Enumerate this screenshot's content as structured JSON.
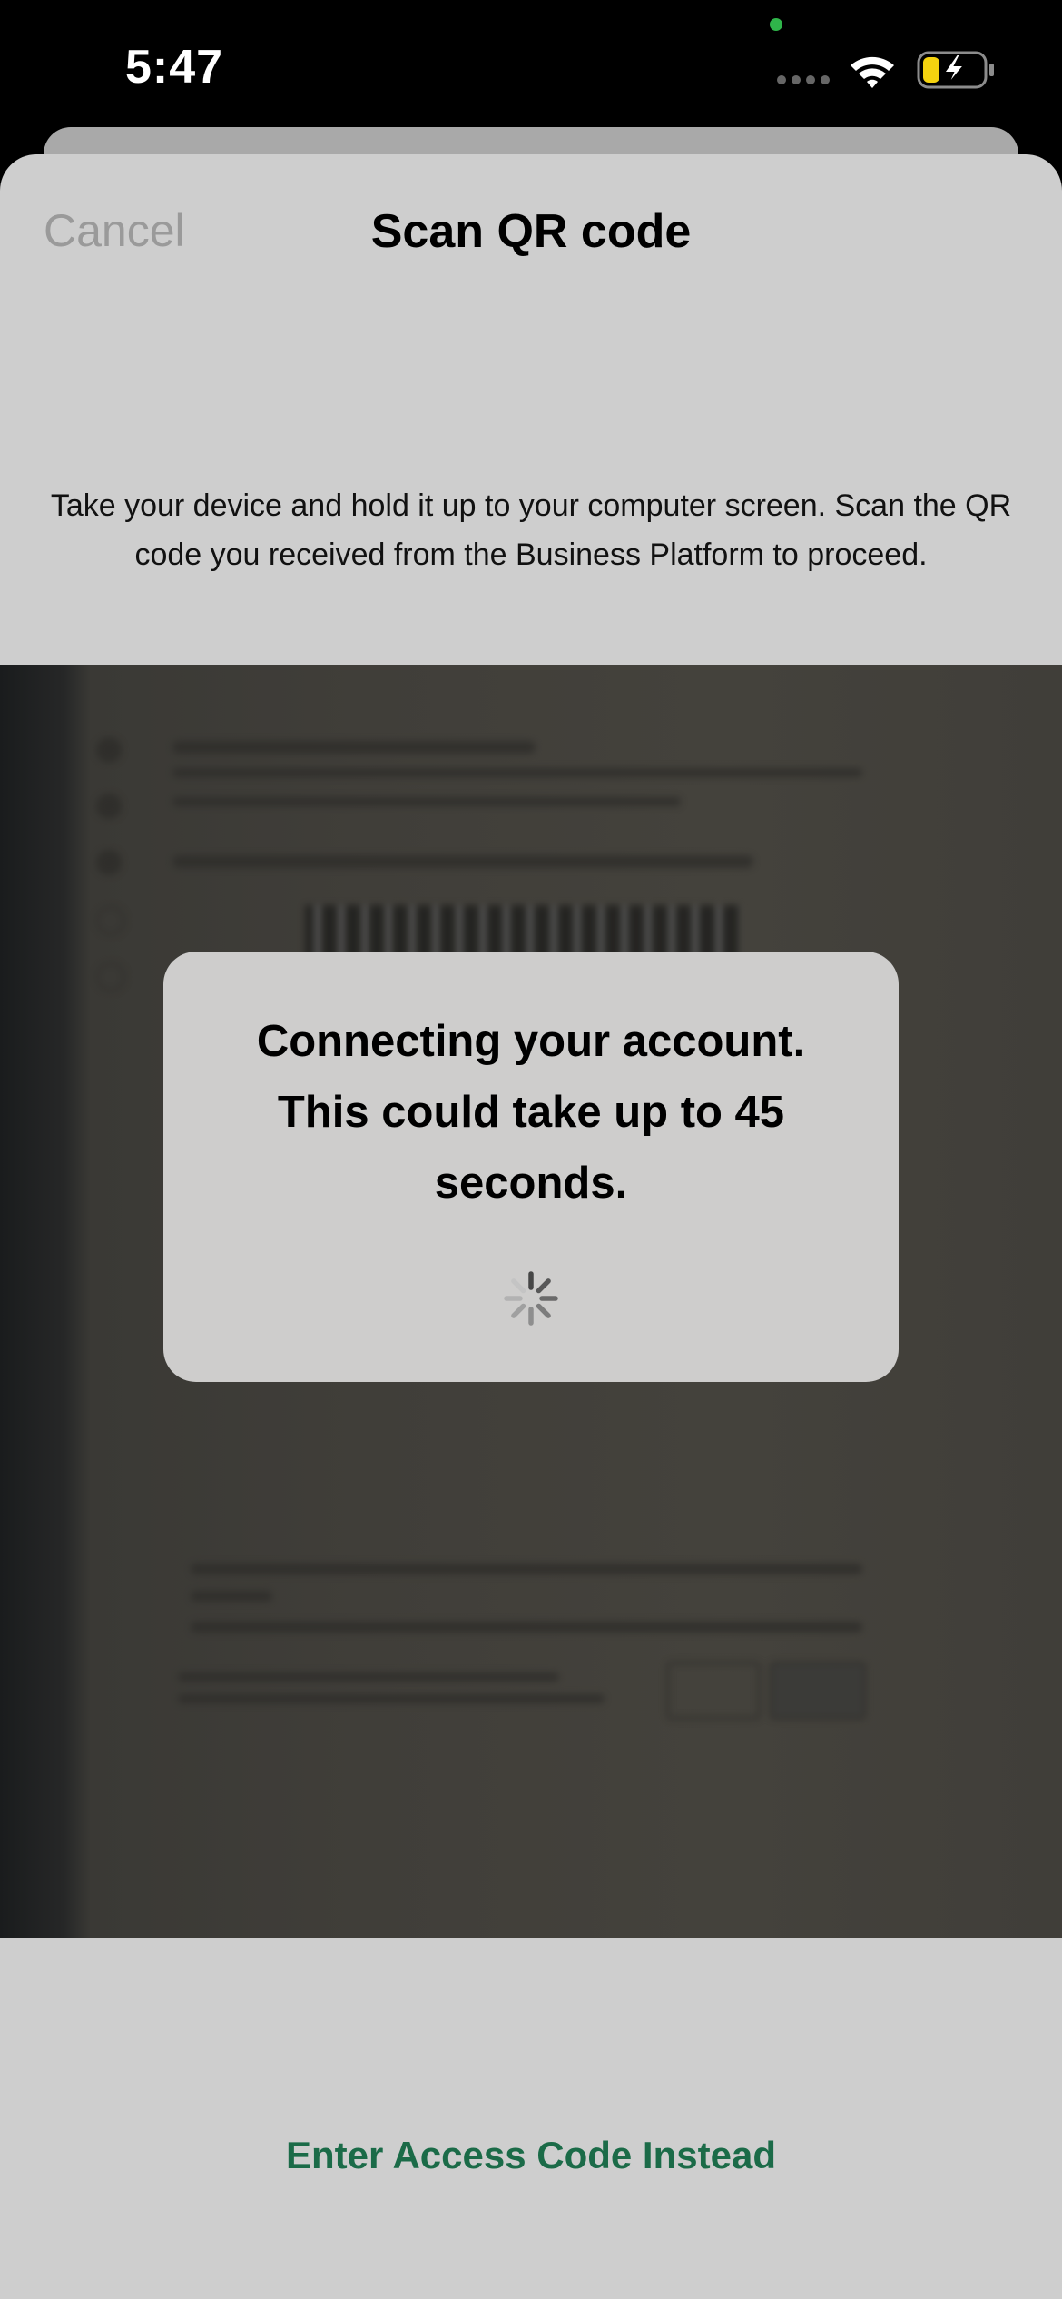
{
  "status_bar": {
    "time": "5:47",
    "camera_dot_color": "#2fb54a",
    "battery_fill_color": "#f5d30f"
  },
  "sheet": {
    "cancel_label": "Cancel",
    "title": "Scan QR code",
    "instructions": "Take your device and hold it up to your computer screen. Scan the QR code you received from the Business Platform to proceed."
  },
  "dialog": {
    "message": "Connecting your account. This could take up to 45 seconds.",
    "spinner_icon": "activity-spinner-icon"
  },
  "footer": {
    "access_code_label": "Enter Access Code Instead",
    "accent_color": "#1b6b48"
  }
}
